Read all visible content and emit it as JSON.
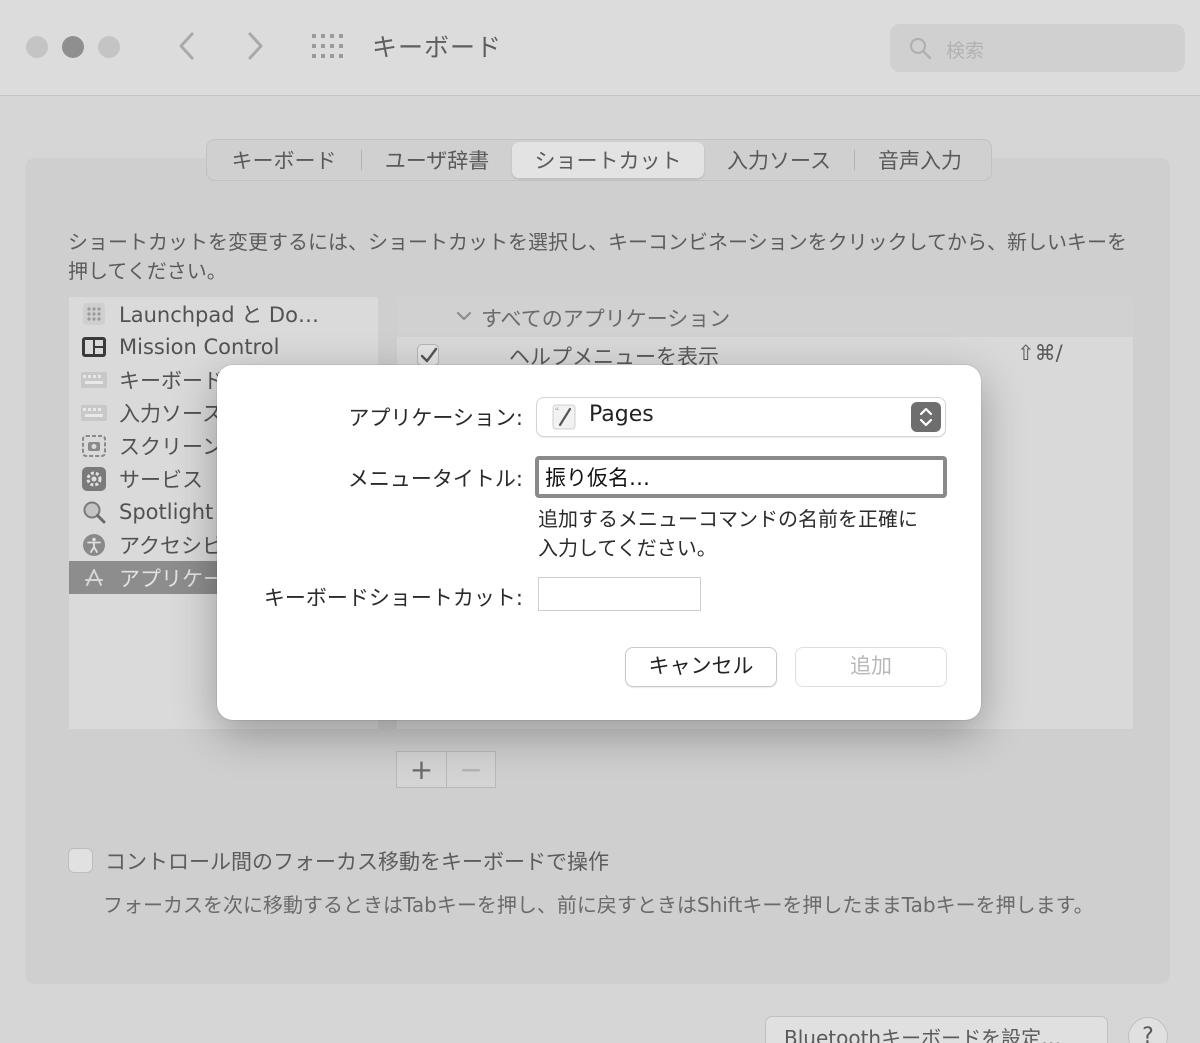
{
  "window": {
    "title": "キーボード",
    "search_placeholder": "検索"
  },
  "tabs": [
    {
      "label": "キーボード",
      "selected": false
    },
    {
      "label": "ユーザ辞書",
      "selected": false
    },
    {
      "label": "ショートカット",
      "selected": true
    },
    {
      "label": "入力ソース",
      "selected": false
    },
    {
      "label": "音声入力",
      "selected": false
    }
  ],
  "description": "ショートカットを変更するには、ショートカットを選択し、キーコンビネーションをクリックしてから、新しいキーを押してください。",
  "categories": [
    {
      "label": "Launchpad と Do…",
      "icon": "launchpad-icon"
    },
    {
      "label": "Mission Control",
      "icon": "mission-control-icon"
    },
    {
      "label": "キーボード",
      "icon": "keyboard-icon"
    },
    {
      "label": "入力ソース",
      "icon": "input-source-icon"
    },
    {
      "label": "スクリーンショット",
      "icon": "screenshot-icon"
    },
    {
      "label": "サービス",
      "icon": "gear-icon"
    },
    {
      "label": "Spotlight",
      "icon": "search-icon"
    },
    {
      "label": "アクセシビリティ",
      "icon": "accessibility-icon"
    },
    {
      "label": "アプリケーション",
      "icon": "app-store-icon",
      "selected": true
    }
  ],
  "shortcut_list": {
    "group_label": "すべてのアプリケーション",
    "rows": [
      {
        "label": "ヘルプメニューを表示",
        "keys": "⇧⌘/",
        "checked": true
      }
    ]
  },
  "plus_label": "+",
  "minus_label": "−",
  "focus_option": {
    "label": "コントロール間のフォーカス移動をキーボードで操作",
    "description": "フォーカスを次に移動するときはTabキーを押し、前に戻すときはShiftキーを押したままTabキーを押します。"
  },
  "bluetooth_button": "Bluetoothキーボードを設定…",
  "help_button": "?",
  "dialog": {
    "application_label": "アプリケーション:",
    "application_value": "Pages",
    "menu_title_label": "メニュータイトル:",
    "menu_title_value": "振り仮名…",
    "hint": "追加するメニューコマンドの名前を正確に入力してください。",
    "shortcut_label": "キーボードショートカット:",
    "shortcut_value": "",
    "cancel_label": "キャンセル",
    "add_label": "追加"
  },
  "colors": {
    "dim_background": "#d6d6d6",
    "dialog_background": "#ffffff",
    "focus_ring": "#8a8a8a",
    "selected_row": "#8d8d8d"
  }
}
